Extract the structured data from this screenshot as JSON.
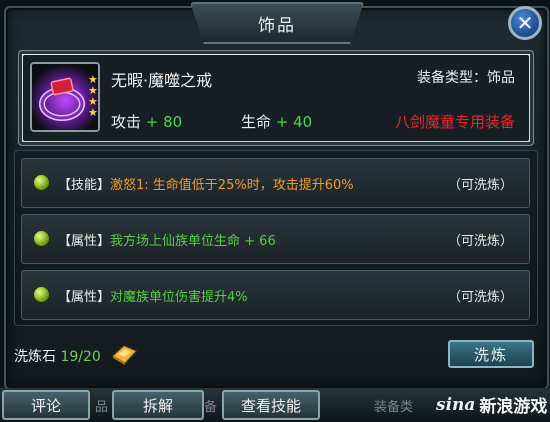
{
  "window": {
    "title": "饰品"
  },
  "item": {
    "name": "无暇·魔噬之戒",
    "type_label": "装备类型：饰品",
    "stats": [
      {
        "label": "攻击",
        "value": "+ 80"
      },
      {
        "label": "生命",
        "value": "+ 40"
      }
    ],
    "exclusive": "八剑魔童专用装备",
    "star_count": 4
  },
  "skills": [
    {
      "tag": "【技能】",
      "text": "激怒1: 生命值低于25%时，攻击提升60%",
      "color": "#f09a2a",
      "refine": "（可洗炼）"
    },
    {
      "tag": "【属性】",
      "text": "我方场上仙族单位生命 + 66",
      "color": "#55cf42",
      "refine": "（可洗炼）"
    },
    {
      "tag": "【属性】",
      "text": "对魔族单位伤害提升4%",
      "color": "#55cf42",
      "refine": "（可洗炼）"
    }
  ],
  "refine_stone": {
    "label": "洗炼石",
    "count": "19/20"
  },
  "buttons": {
    "refine": "洗炼",
    "comment": "评论",
    "dismantle": "拆解",
    "view_skills": "查看技能"
  },
  "behind": {
    "text_a": "品",
    "text_b": "备",
    "text_c": "装备类"
  },
  "watermark": {
    "brand": "sina",
    "cn": "新浪游戏"
  }
}
